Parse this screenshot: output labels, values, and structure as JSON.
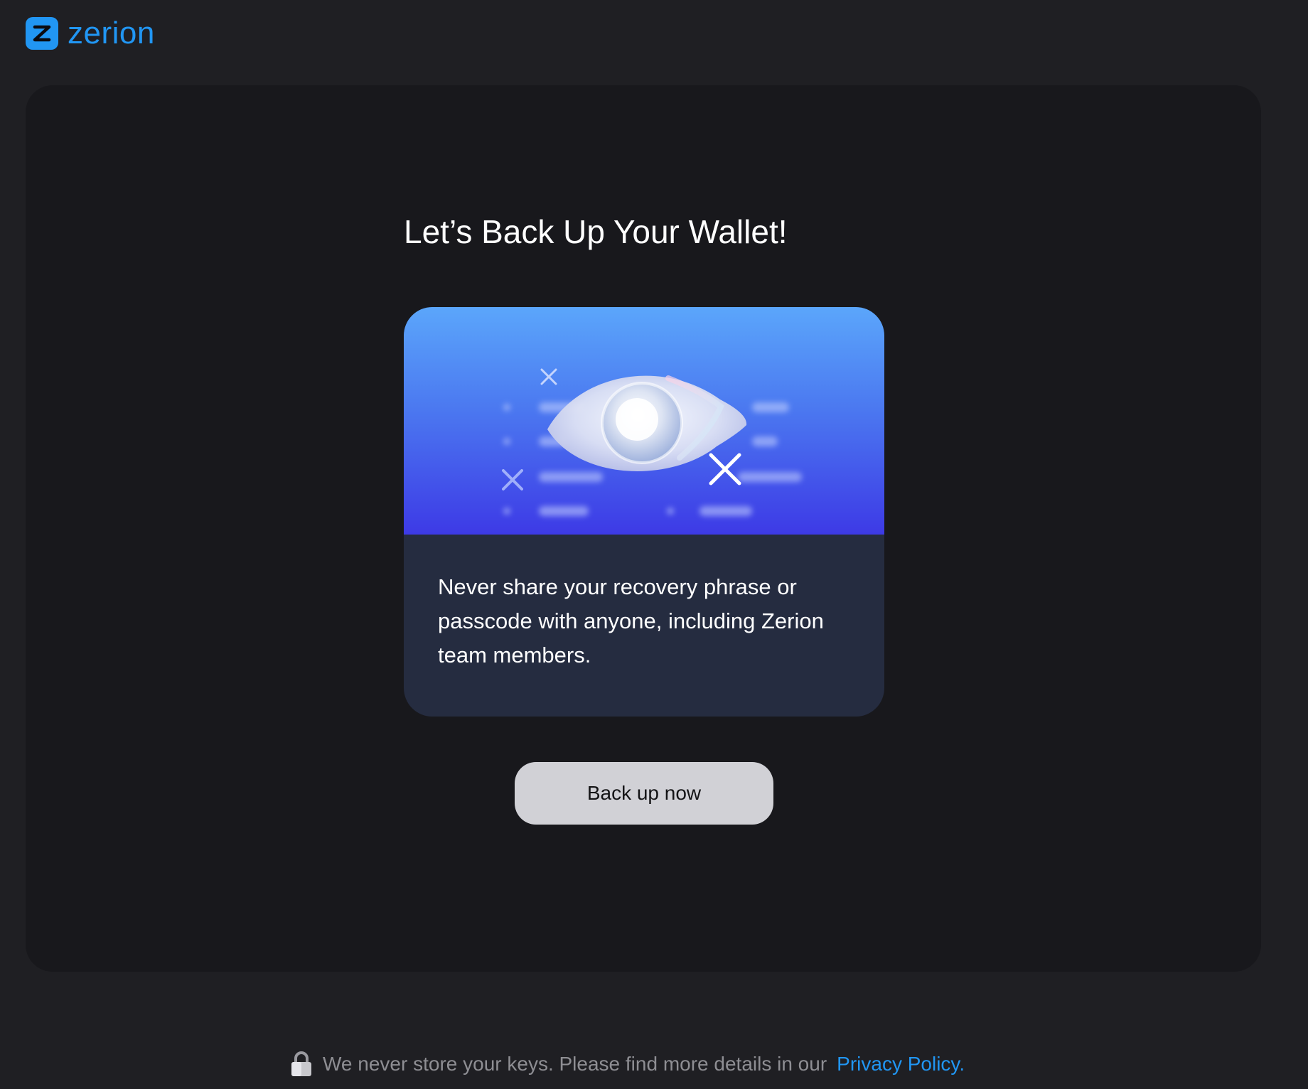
{
  "brand": {
    "name": "zerion",
    "color": "#2196f3"
  },
  "main": {
    "title": "Let’s Back Up Your Wallet!",
    "warning_text": "Never share your recovery phrase or passcode with anyone, including Zerion team members.",
    "backup_button_label": "Back up now",
    "illustration_icon": "eye-icon"
  },
  "footer": {
    "text": "We never store your keys. Please find more details in our",
    "link_label": "Privacy Policy.",
    "icon": "lock-icon"
  }
}
